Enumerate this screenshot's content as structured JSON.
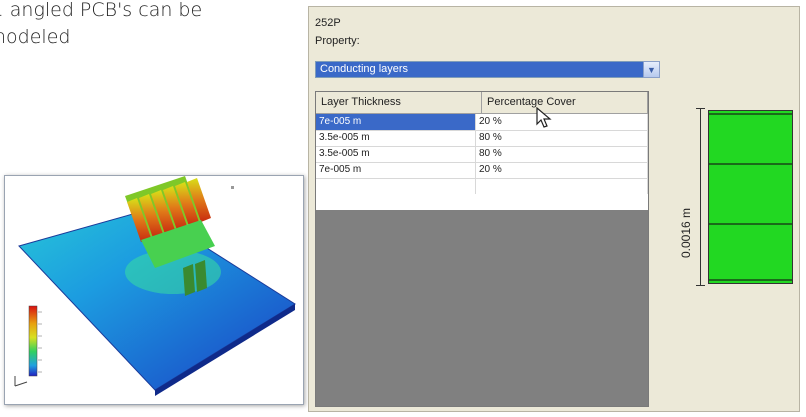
{
  "caption": {
    "line1": "e. angled PCB's can be",
    "line2": "nodeled"
  },
  "dialog": {
    "title": "252P",
    "property_label": "Property:",
    "property_value": "Conducting layers",
    "table": {
      "columns": [
        "Layer Thickness",
        "Percentage Cover"
      ],
      "rows": [
        [
          "7e-005 m",
          "20 %"
        ],
        [
          "3.5e-005 m",
          "80 %"
        ],
        [
          "3.5e-005 m",
          "80 %"
        ],
        [
          "7e-005 m",
          "20 %"
        ]
      ],
      "selected_row": 0
    }
  },
  "stack_preview": {
    "dimension_label": "0.0016 m",
    "fill_color": "#22d822",
    "line_color": "#1a6b1a"
  },
  "icons": {
    "dropdown": "chevron-down-icon",
    "cursor": "mouse-pointer-icon"
  }
}
